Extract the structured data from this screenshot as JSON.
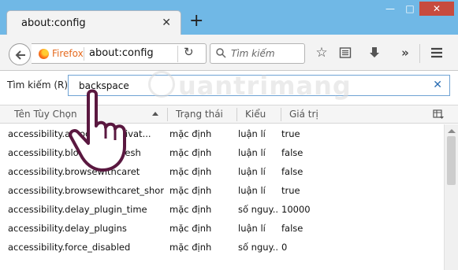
{
  "tab": {
    "title": "about:config",
    "close_icon": "close-icon"
  },
  "window": {
    "new_tab_icon": "plus-icon"
  },
  "navbar": {
    "identity_label": "Firefox",
    "url": "about:config",
    "search_placeholder": "Tìm kiếm"
  },
  "filter": {
    "label": "Tìm kiếm (R):",
    "value": "backspace"
  },
  "table": {
    "columns": [
      "Tên Tùy Chọn",
      "Trạng thái",
      "Kiểu",
      "Giá trị"
    ],
    "rows": [
      {
        "name": "accessibility.autocaret.activat...",
        "status": "mặc định",
        "type": "luận lí",
        "value": "true"
      },
      {
        "name": "accessibility.blockautorefresh",
        "status": "mặc định",
        "type": "luận lí",
        "value": "false"
      },
      {
        "name": "accessibility.browsewithcaret",
        "status": "mặc định",
        "type": "luận lí",
        "value": "false"
      },
      {
        "name": "accessibility.browsewithcaret_short...",
        "status": "mặc định",
        "type": "luận lí",
        "value": "true"
      },
      {
        "name": "accessibility.delay_plugin_time",
        "status": "mặc định",
        "type": "số nguy...",
        "value": "10000"
      },
      {
        "name": "accessibility.delay_plugins",
        "status": "mặc định",
        "type": "luận lí",
        "value": "false"
      },
      {
        "name": "accessibility.force_disabled",
        "status": "mặc định",
        "type": "số nguy...",
        "value": "0"
      }
    ]
  },
  "watermark": "uantrimang",
  "colors": {
    "titlebar": "#70b8e6",
    "close_button": "#c74b3e",
    "filter_border": "#6fa3d4",
    "firefox_label": "#e56a1e"
  }
}
